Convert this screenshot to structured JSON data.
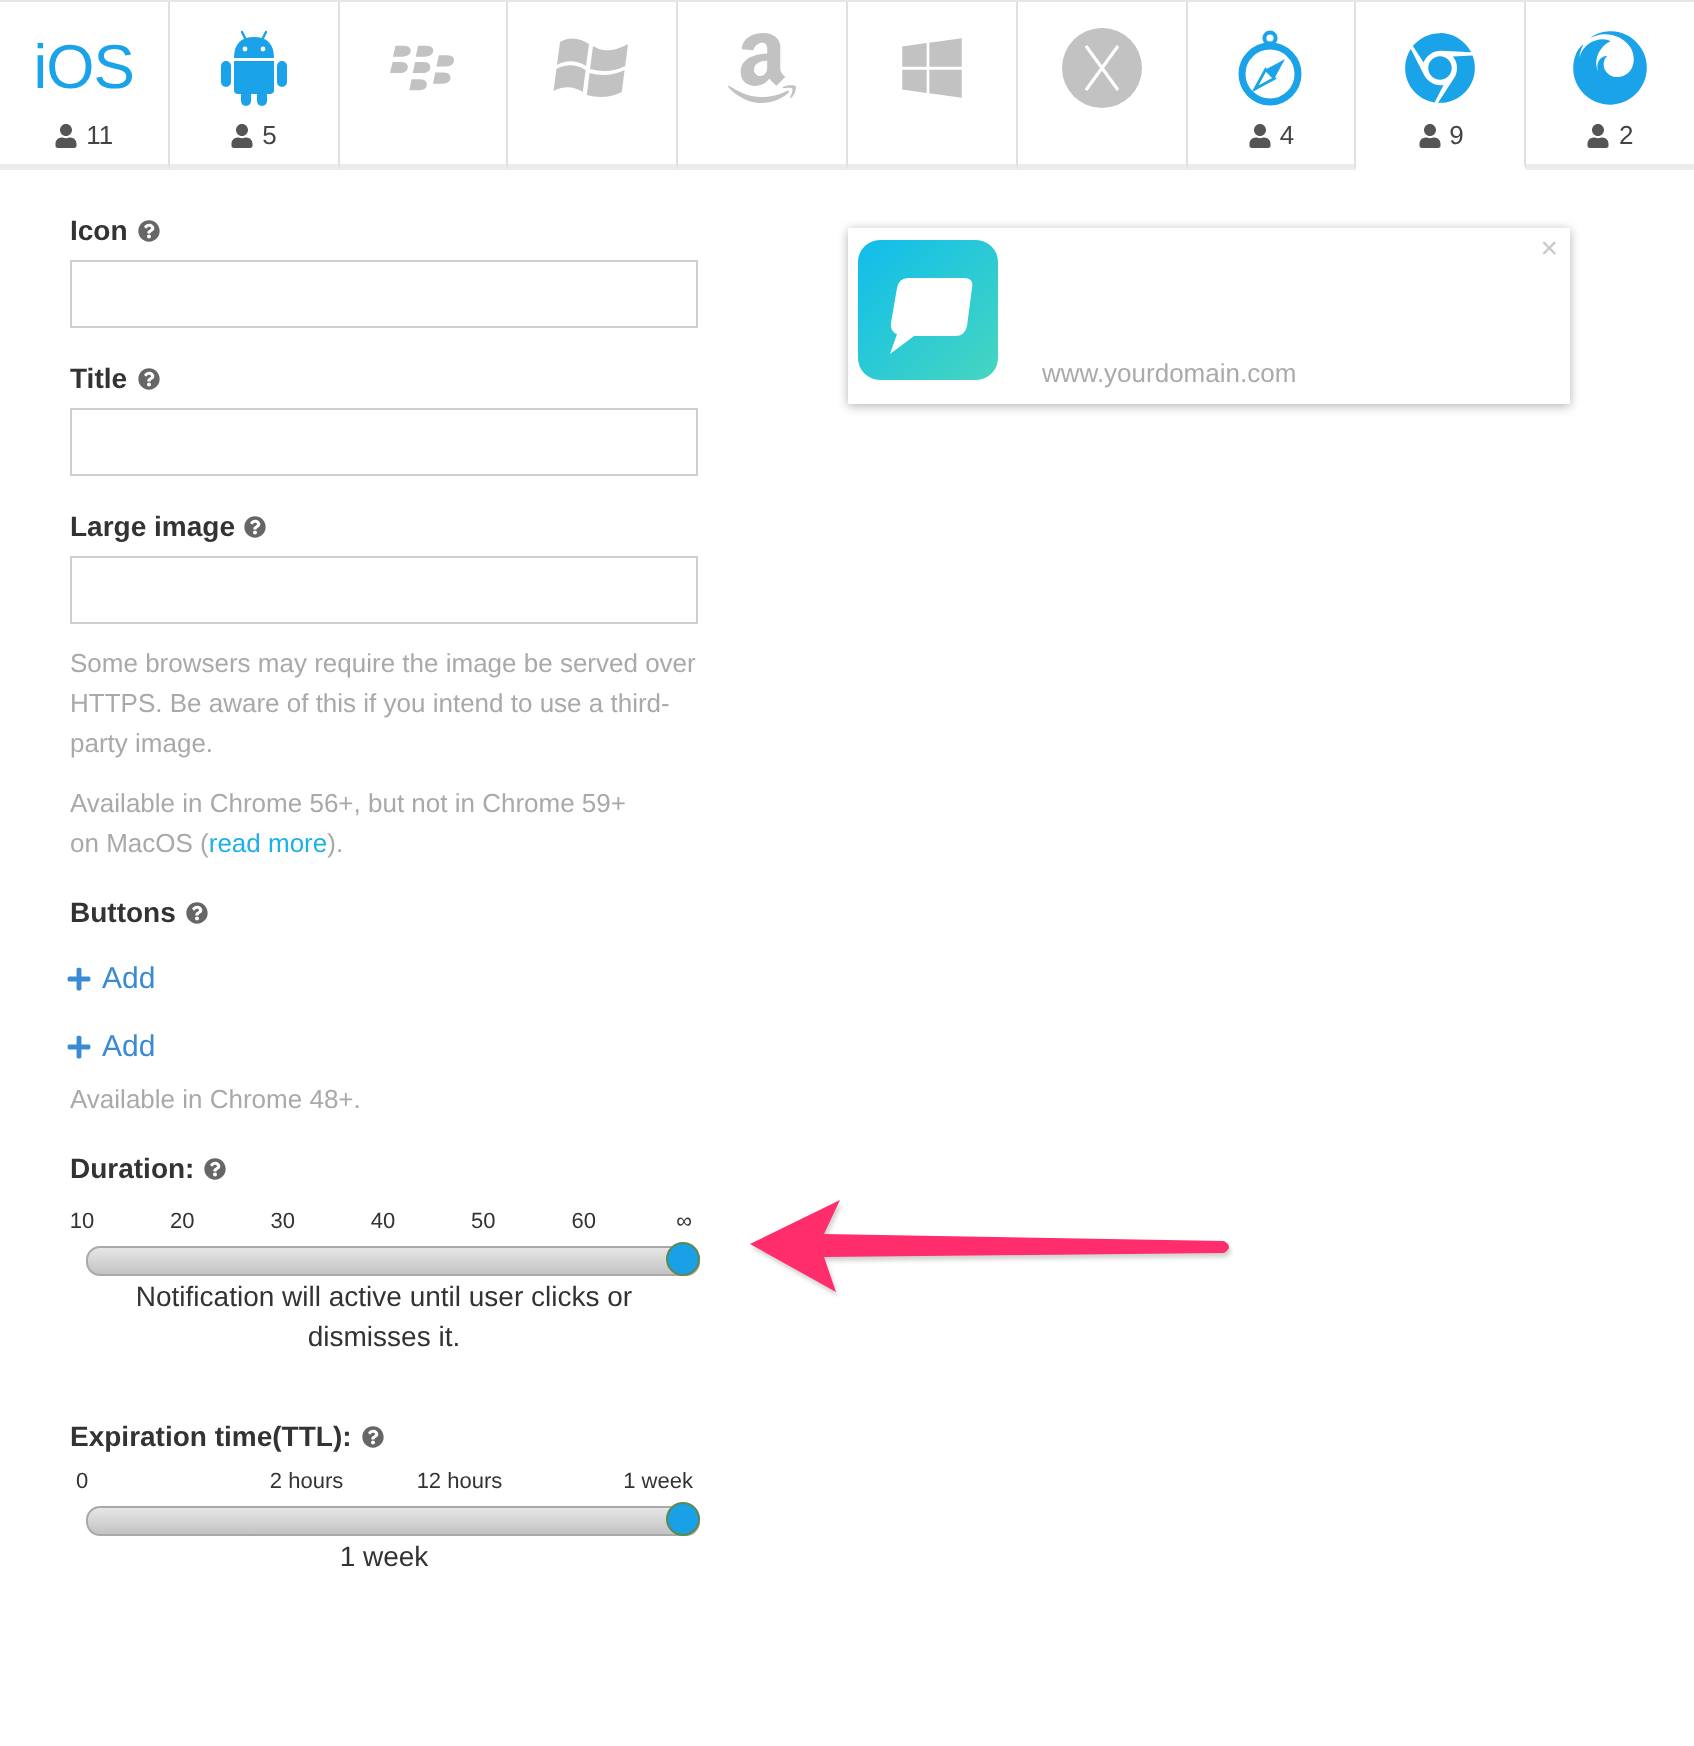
{
  "platform_tabs": [
    {
      "kind": "ios",
      "label": "iOS",
      "active": true,
      "count": "11",
      "selected": false
    },
    {
      "kind": "android",
      "active": true,
      "count": "5",
      "selected": false
    },
    {
      "kind": "blackberry",
      "active": false,
      "selected": false
    },
    {
      "kind": "windows_flag",
      "active": false,
      "selected": false
    },
    {
      "kind": "amazon",
      "active": false,
      "selected": false
    },
    {
      "kind": "windows",
      "active": false,
      "selected": false
    },
    {
      "kind": "macos",
      "active": false,
      "selected": false
    },
    {
      "kind": "safari",
      "active": true,
      "count": "4",
      "selected": false
    },
    {
      "kind": "chrome",
      "active": true,
      "count": "9",
      "selected": true
    },
    {
      "kind": "firefox",
      "active": true,
      "count": "2",
      "selected": false
    }
  ],
  "form": {
    "fields": [
      {
        "label": "Icon"
      },
      {
        "label": "Title"
      },
      {
        "label": "Large image",
        "notes": [
          {
            "text": "Some browsers may require the image be served over HTTPS. Be aware of this if you intend to use a third-party image."
          },
          {
            "text": "Available in Chrome 56+, but not in Chrome 59+ on MacOS (",
            "link": "read more",
            "text_after": ")."
          }
        ]
      }
    ],
    "buttons": {
      "label": "Buttons",
      "add": [
        "Add",
        "Add"
      ],
      "note": "Available in Chrome 48+."
    },
    "sliders": [
      {
        "label": "Duration:",
        "ticks": [
          "10",
          "20",
          "30",
          "40",
          "50",
          "60",
          "∞"
        ],
        "level": 1,
        "caption": "Notification will active until user clicks or dismisses it."
      },
      {
        "label": "Expiration time(TTL):",
        "ticks": [
          "0",
          "2 hours",
          "12 hours",
          "1 week"
        ],
        "level": 1,
        "caption": "1 week"
      }
    ]
  },
  "preview": {
    "url": "www.yourdomain.com",
    "close": "×"
  }
}
